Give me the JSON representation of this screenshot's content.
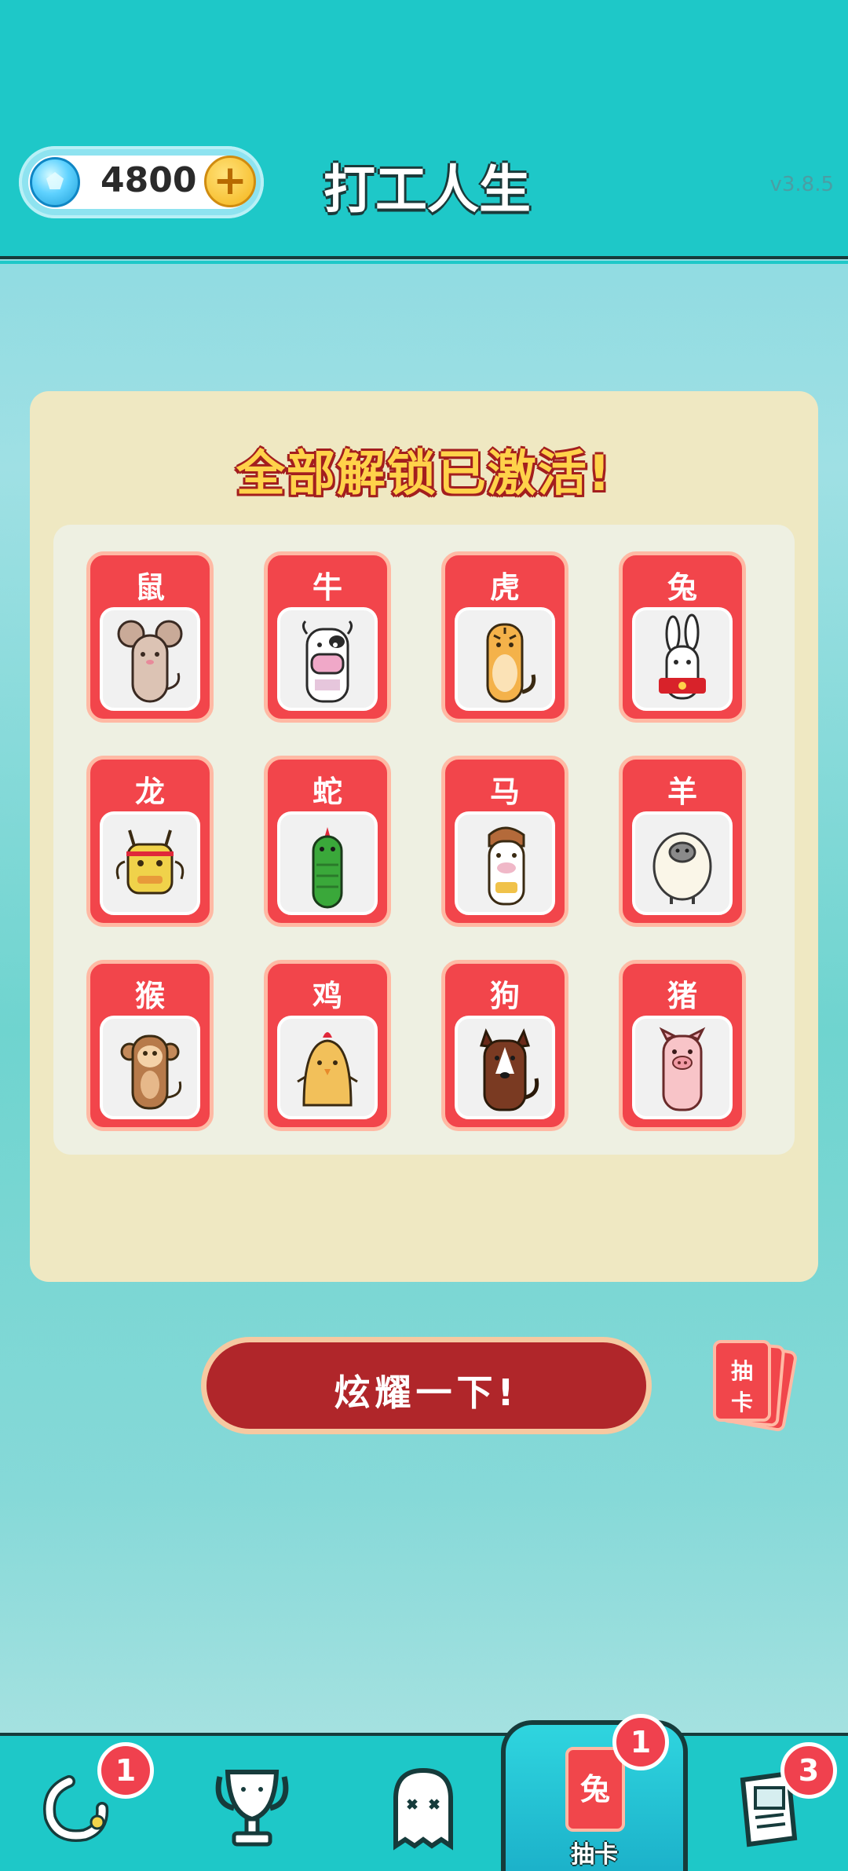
{
  "header": {
    "gems": "4800",
    "add_icon": "plus-icon",
    "title": "打工人生",
    "version": "v3.8.5"
  },
  "panel": {
    "title": "全部解锁已激活!",
    "cards": [
      {
        "label": "鼠",
        "icon": "rat-icon"
      },
      {
        "label": "牛",
        "icon": "ox-icon"
      },
      {
        "label": "虎",
        "icon": "tiger-icon"
      },
      {
        "label": "兔",
        "icon": "rabbit-icon"
      },
      {
        "label": "龙",
        "icon": "dragon-icon"
      },
      {
        "label": "蛇",
        "icon": "snake-icon"
      },
      {
        "label": "马",
        "icon": "horse-icon"
      },
      {
        "label": "羊",
        "icon": "sheep-icon"
      },
      {
        "label": "猴",
        "icon": "monkey-icon"
      },
      {
        "label": "鸡",
        "icon": "chicken-icon"
      },
      {
        "label": "狗",
        "icon": "dog-icon"
      },
      {
        "label": "猪",
        "icon": "pig-icon"
      }
    ]
  },
  "actions": {
    "show_off_label": "炫耀一下!",
    "draw_card_top": "抽",
    "draw_card_bottom": "卡"
  },
  "bottom_nav": {
    "items": [
      {
        "icon": "refresh-icon",
        "badge": "1"
      },
      {
        "icon": "trophy-icon"
      },
      {
        "icon": "ghost-icon"
      },
      {
        "icon": "card-draw-icon",
        "card_char": "兔",
        "label": "抽卡",
        "badge": "1",
        "active": true
      },
      {
        "icon": "book-icon",
        "badge": "3"
      }
    ]
  },
  "colors": {
    "teal": "#1ec8c8",
    "card_red": "#f2454b",
    "button_red": "#b0262a",
    "panel_bg": "#efe8c2"
  }
}
